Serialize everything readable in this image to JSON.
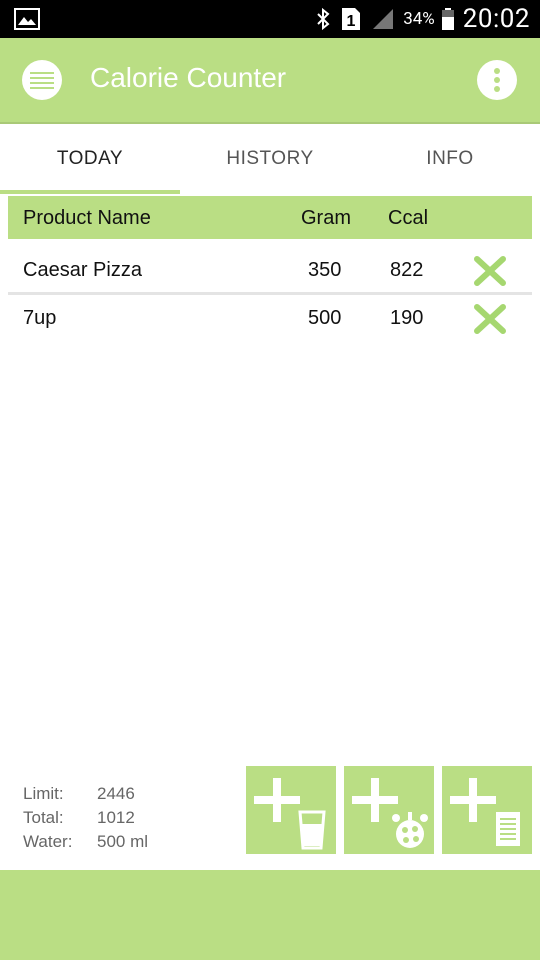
{
  "status_bar": {
    "battery_percent": "34%",
    "time": "20:02",
    "sim_label": "1",
    "icons": [
      "gallery-icon",
      "bluetooth-icon",
      "sim-icon",
      "signal-icon",
      "battery-icon"
    ]
  },
  "app_bar": {
    "title": "Calorie Counter",
    "icons": [
      "menu-icon",
      "overflow-menu-icon"
    ]
  },
  "tabs": [
    {
      "label": "TODAY",
      "active": true
    },
    {
      "label": "HISTORY",
      "active": false
    },
    {
      "label": "INFO",
      "active": false
    }
  ],
  "table": {
    "headers": {
      "name": "Product Name",
      "gram": "Gram",
      "ccal": "Ccal"
    },
    "rows": [
      {
        "name": "Caesar Pizza",
        "gram": "350",
        "ccal": "822"
      },
      {
        "name": "7up",
        "gram": "500",
        "ccal": "190"
      }
    ]
  },
  "summary": {
    "limit_label": "Limit:",
    "limit_value": "2446",
    "total_label": "Total:",
    "total_value": "1012",
    "water_label": "Water:",
    "water_value": "500 ml"
  },
  "actions": [
    "add-water-icon",
    "add-food-icon",
    "add-list-icon"
  ],
  "colors": {
    "accent": "#bade84",
    "delete": "#a6d770",
    "status_bar": "#000000"
  }
}
